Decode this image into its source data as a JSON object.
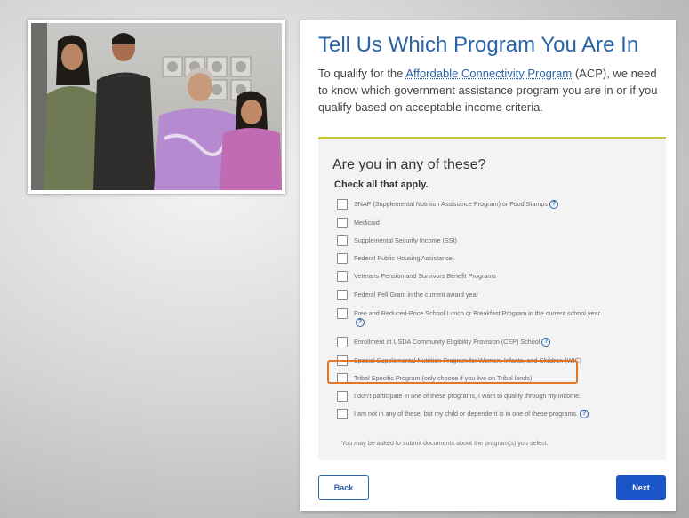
{
  "header": {
    "title": "Tell Us Which Program You Are In",
    "intro_before": "To qualify for the ",
    "intro_link": "Affordable Connectivity Program",
    "intro_after": " (ACP), we need to know which government assistance program you are in or if you qualify based on acceptable income criteria."
  },
  "question": {
    "title": "Are you in any of these?",
    "subtitle": "Check all that apply."
  },
  "options": [
    {
      "label": "SNAP (Supplemental Nutrition Assistance Program) or Food Stamps",
      "help": true,
      "checked": false
    },
    {
      "label": "Medicaid",
      "help": false,
      "checked": false
    },
    {
      "label": "Supplemental Security Income (SSI)",
      "help": false,
      "checked": false
    },
    {
      "label": "Federal Public Housing Assistance",
      "help": false,
      "checked": false
    },
    {
      "label": "Veterans Pension and Survivors Benefit Programs",
      "help": false,
      "checked": false
    },
    {
      "label": "Federal Pell Grant in the current award year",
      "help": false,
      "checked": false
    },
    {
      "label": "Free and Reduced-Price School Lunch or Breakfast Program in the current school year",
      "help": true,
      "checked": false
    },
    {
      "label": "Enrollment at USDA Community Eligibility Provision (CEP) School",
      "help": true,
      "checked": false
    },
    {
      "label": "Special Supplemental Nutrition Program for Women, Infants, and Children (WIC)",
      "help": false,
      "checked": false
    },
    {
      "label": "Tribal Specific Program (only choose if you live on Tribal lands)",
      "help": false,
      "checked": false
    },
    {
      "label": "I don't participate in one of these programs, I want to qualify through my income.",
      "help": false,
      "checked": false
    },
    {
      "label": "I am not in any of these, but my child or dependent is in one of these programs.",
      "help": true,
      "checked": false
    }
  ],
  "help_glyph": "?",
  "note": "You may be asked to submit documents about the program(s) you select.",
  "buttons": {
    "back": "Back",
    "next": "Next"
  },
  "colors": {
    "accent_blue": "#2c63a6",
    "primary_button": "#1a56c8",
    "panel_rule": "#c3c83b",
    "highlight": "#e07628"
  },
  "photo": {
    "description_icon": "family-photo"
  }
}
